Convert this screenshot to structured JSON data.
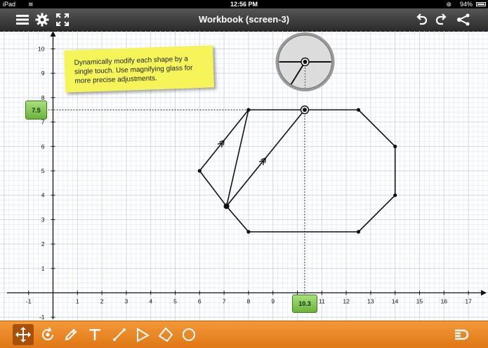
{
  "status_bar": {
    "carrier": "iPad",
    "time": "12:56 PM",
    "battery": "94%"
  },
  "toolbar": {
    "title": "Workbook (screen-3)",
    "left_icons": [
      "menu-icon",
      "gear-icon",
      "fullscreen-icon"
    ],
    "right_icons": [
      "undo-icon",
      "redo-icon",
      "share-icon"
    ]
  },
  "note": {
    "text": "Dynamically modify each shape by a single touch. Use magnifying glass for more precise adjustments."
  },
  "axes": {
    "x_ticks": [
      "-1",
      "1",
      "2",
      "3",
      "4",
      "5",
      "6",
      "7",
      "8",
      "9",
      "10",
      "11",
      "12",
      "13",
      "14",
      "15",
      "16",
      "17"
    ],
    "y_ticks": [
      "-1",
      "1",
      "2",
      "3",
      "4",
      "5",
      "6",
      "7",
      "8",
      "9",
      "10"
    ],
    "x_range": [
      -1.5,
      17.5
    ],
    "y_range": [
      -1.3,
      10.7
    ]
  },
  "selected_point": {
    "x": 10.3,
    "y": 7.5,
    "x_label": "10.3",
    "y_label": "7.5"
  },
  "shapes": {
    "octagon": [
      [
        8,
        7.5
      ],
      [
        10.3,
        7.5
      ],
      [
        12.5,
        7.5
      ],
      [
        14,
        6
      ],
      [
        14,
        4
      ],
      [
        12.5,
        2.5
      ],
      [
        8,
        2.5
      ],
      [
        7.1,
        3.55
      ]
    ],
    "parallelogram": [
      [
        6,
        5
      ],
      [
        8,
        7.5
      ],
      [
        10.3,
        7.5
      ],
      [
        7.1,
        3.55
      ]
    ],
    "large_points": [
      [
        7.1,
        3.55
      ]
    ],
    "arrow_edges": [
      [
        [
          6,
          5
        ],
        [
          8,
          7.5
        ]
      ],
      [
        [
          7.1,
          3.55
        ],
        [
          10.3,
          7.5
        ]
      ]
    ]
  },
  "bottom_tools": [
    {
      "icon": "move-icon",
      "selected": true
    },
    {
      "icon": "rotate-icon",
      "selected": false
    },
    {
      "icon": "pencil-icon",
      "selected": false
    },
    {
      "icon": "text-icon",
      "selected": false
    },
    {
      "icon": "line-icon",
      "selected": false
    },
    {
      "icon": "triangle-icon",
      "selected": false
    },
    {
      "icon": "quadrilateral-icon",
      "selected": false
    },
    {
      "icon": "circle-icon",
      "selected": false
    },
    {
      "icon": "magnet-icon",
      "selected": false
    }
  ]
}
